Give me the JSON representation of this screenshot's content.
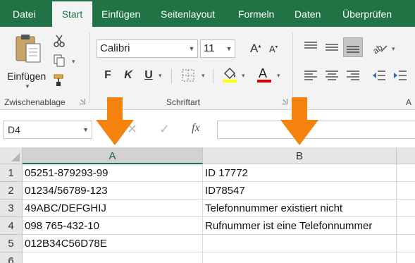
{
  "ribbon_tabs": [
    "Datei",
    "Start",
    "Einfügen",
    "Seitenlayout",
    "Formeln",
    "Daten",
    "Überprüfen"
  ],
  "active_tab": "Start",
  "clipboard": {
    "paste_label": "Einfügen",
    "group_label": "Zwischenablage"
  },
  "font": {
    "name": "Calibri",
    "size": "11",
    "bold": "F",
    "italic": "K",
    "underline": "U",
    "group_label": "Schriftart"
  },
  "alignment_group_label": "A",
  "formula_bar": {
    "name_box": "D4",
    "fx": "fx",
    "value": ""
  },
  "columns": [
    "A",
    "B"
  ],
  "rows": [
    {
      "num": "1",
      "a": "05251-879293-99",
      "b": "ID 17772"
    },
    {
      "num": "2",
      "a": "01234/56789-123",
      "b": "ID78547"
    },
    {
      "num": "3",
      "a": "49ABC/DEFGHIJ",
      "b": "Telefonnummer existiert nicht"
    },
    {
      "num": "4",
      "a": "098 765-432-10",
      "b": "Rufnummer ist eine Telefonnummer"
    },
    {
      "num": "5",
      "a": "012B34C56D78E",
      "b": ""
    },
    {
      "num": "6",
      "a": "",
      "b": ""
    }
  ],
  "colors": {
    "accent": "#217346",
    "arrow": "#f5820d",
    "font_color_bar": "#e00000",
    "highlight_bar": "#ffff00"
  }
}
